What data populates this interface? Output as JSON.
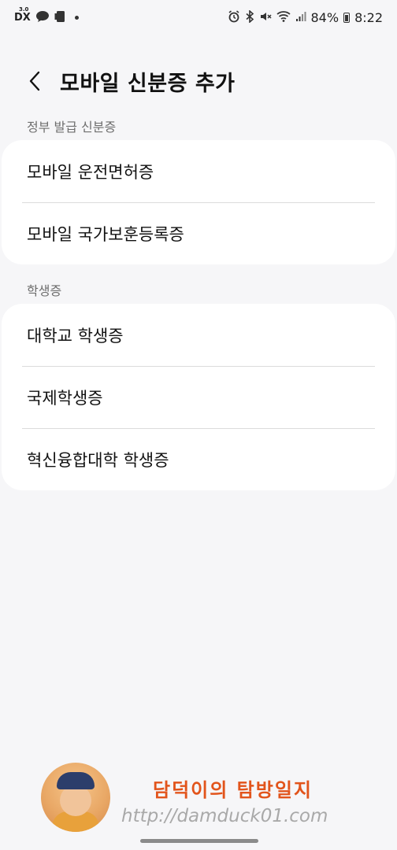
{
  "status_bar": {
    "battery": "84%",
    "time": "8:22",
    "left_icons": [
      "dx-icon",
      "chat-icon",
      "tablet-icon",
      "dot-icon"
    ],
    "right_icons": [
      "alarm-icon",
      "bluetooth-icon",
      "mute-icon",
      "wifi-icon",
      "signal-icon",
      "battery-icon"
    ]
  },
  "header": {
    "title": "모바일 신분증 추가"
  },
  "sections": [
    {
      "label": "정부 발급 신분증",
      "items": [
        {
          "label": "모바일 운전면허증"
        },
        {
          "label": "모바일 국가보훈등록증"
        }
      ]
    },
    {
      "label": "학생증",
      "items": [
        {
          "label": "대학교 학생증"
        },
        {
          "label": "국제학생증"
        },
        {
          "label": "혁신융합대학 학생증"
        }
      ]
    }
  ],
  "watermark": {
    "name": "담덕이의 탐방일지",
    "url": "http://damduck01.com"
  }
}
